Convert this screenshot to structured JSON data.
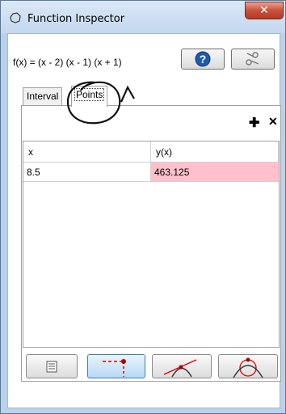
{
  "window": {
    "title": "Function Inspector"
  },
  "function_text": "f(x) = (x - 2) (x - 1) (x + 1)",
  "tabs": [
    {
      "label": "Interval"
    },
    {
      "label": "Points"
    }
  ],
  "table": {
    "columns": [
      "x",
      "y(x)"
    ],
    "rows": [
      {
        "x": "8.5",
        "y": "463.125"
      }
    ]
  },
  "colors": {
    "selected_cell": "#ffc0cb",
    "accent": "#3c7fb1"
  },
  "icons": {
    "help": "help-icon",
    "tools": "scissors-tools-icon",
    "add": "plus-icon",
    "remove": "x-icon",
    "table_view": "table-icon",
    "point_trace": "point-trace-icon",
    "tangent": "tangent-icon",
    "osculating": "osculating-circle-icon"
  }
}
